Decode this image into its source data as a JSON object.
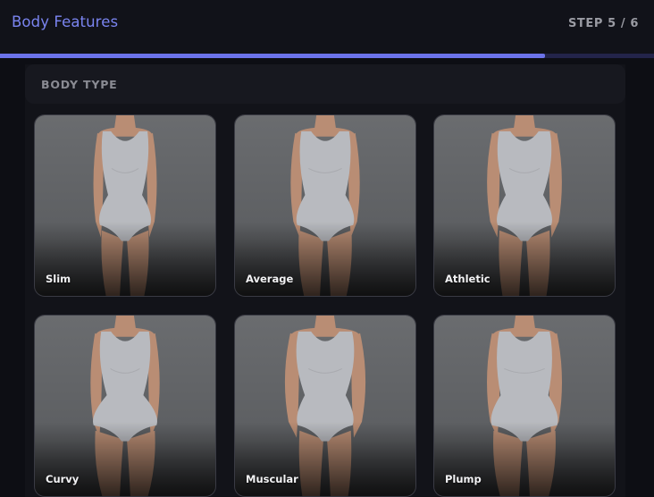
{
  "header": {
    "title": "Body Features",
    "step": "STEP 5 / 6",
    "progress": 0.833
  },
  "section": {
    "label": "BODY TYPE"
  },
  "options": [
    {
      "label": "Slim",
      "shape": "slim"
    },
    {
      "label": "Average",
      "shape": "average"
    },
    {
      "label": "Athletic",
      "shape": "athletic"
    },
    {
      "label": "Curvy",
      "shape": "curvy"
    },
    {
      "label": "Muscular",
      "shape": "muscular"
    },
    {
      "label": "Plump",
      "shape": "plump"
    }
  ],
  "colors": {
    "accent": "#7a84f0",
    "progress": "#6c73ea",
    "background": "#0d0e14",
    "suit": "#b8babf",
    "skin": "#b98d74"
  },
  "icons": {
    "card_image": "figure-icon"
  }
}
